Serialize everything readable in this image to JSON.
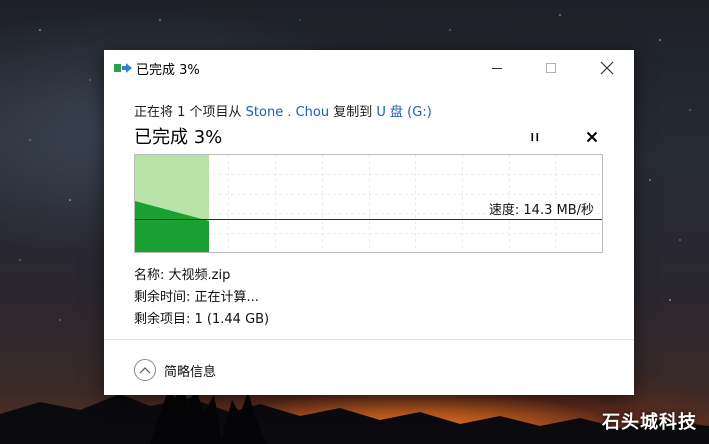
{
  "window": {
    "title": "已完成 3%",
    "app_icon": "copy-progress-icon"
  },
  "transfer": {
    "desc_prefix": "正在将 1 个项目从 ",
    "source": "Stone . Chou",
    "desc_middle": " 复制到 ",
    "destination": "U 盘 (G:)",
    "status": "已完成 3%",
    "percent": 3,
    "speed": "速度: 14.3 MB/秒"
  },
  "controls": {
    "pause_icon": "pause-icon",
    "cancel_icon": "close-icon"
  },
  "details": {
    "name": "名称: 大视频.zip",
    "time_remaining": "剩余时间: 正在计算...",
    "items_remaining": "剩余项目: 1 (1.44 GB)"
  },
  "footer": {
    "toggle_label": "简略信息",
    "toggle_icon": "chevron-up-icon"
  },
  "watermark": "石头城科技",
  "colors": {
    "progress_light": "#b7e3a8",
    "progress_dark": "#18a030",
    "link": "#1a5fb4"
  }
}
